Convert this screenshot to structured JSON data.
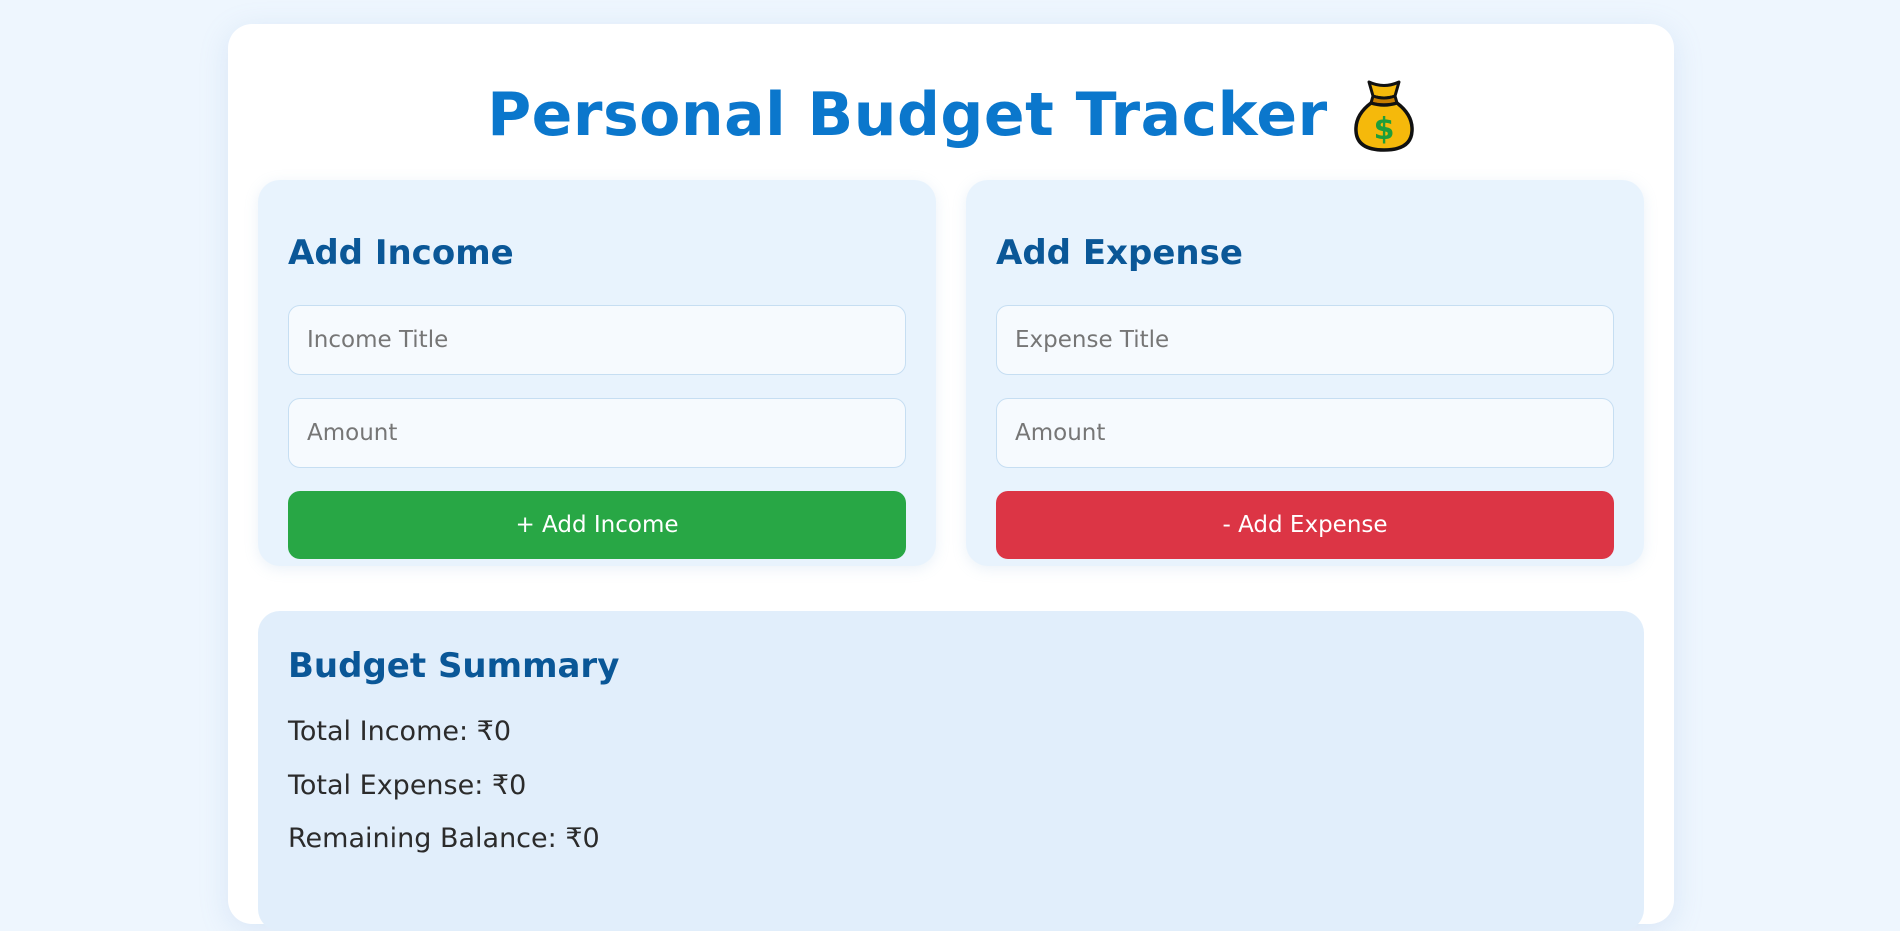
{
  "header": {
    "title": "Personal Budget Tracker",
    "icon": "money-bag-icon"
  },
  "income": {
    "heading": "Add Income",
    "title_placeholder": "Income Title",
    "amount_placeholder": "Amount",
    "button_label": "+ Add Income",
    "button_color": "#28a745"
  },
  "expense": {
    "heading": "Add Expense",
    "title_placeholder": "Expense Title",
    "amount_placeholder": "Amount",
    "button_label": "- Add Expense",
    "button_color": "#dc3545"
  },
  "summary": {
    "heading": "Budget Summary",
    "total_income": "Total Income: ₹0",
    "total_expense": "Total Expense: ₹0",
    "remaining_balance": "Remaining Balance: ₹0"
  },
  "colors": {
    "page_background": "#eef6fe",
    "title": "#0b77cc",
    "heading": "#0a5797",
    "card_background": "#e8f3fd"
  }
}
